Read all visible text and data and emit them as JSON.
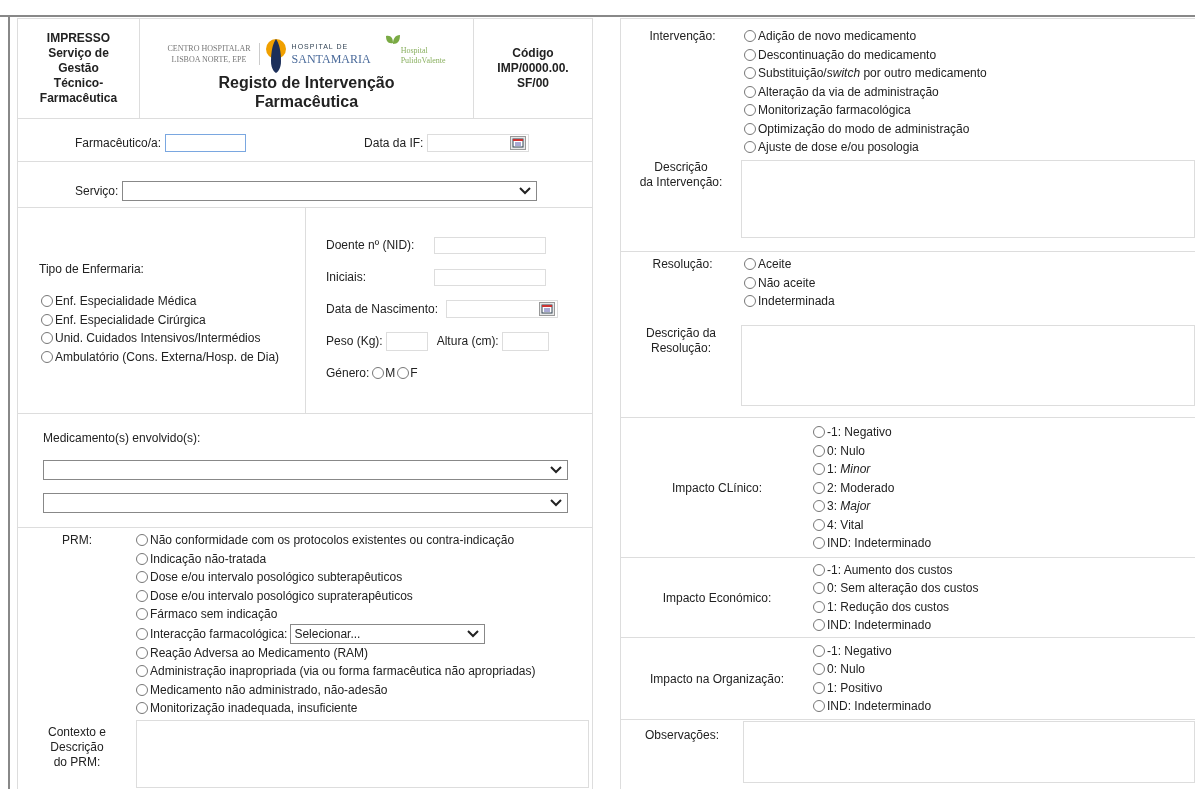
{
  "header": {
    "title_lines": [
      "IMPRESSO",
      "Serviço de",
      "Gestão",
      "Técnico-",
      "Farmacêutica"
    ],
    "logos": [
      {
        "kind": "chln",
        "lines": [
          "CENTRO HOSPITALAR",
          "LISBOA NORTE, EPE"
        ]
      },
      {
        "kind": "hsm",
        "lines": [
          "HOSPITAL DE",
          "SANTAMARIA"
        ]
      },
      {
        "kind": "hpv",
        "lines": [
          "Hospital",
          "PulidoValente"
        ]
      }
    ],
    "form_title": "Registo de Intervenção Farmacêutica",
    "code_lines": [
      "Código",
      "IMP/0000.00.",
      "SF/00"
    ]
  },
  "identification": [
    {
      "label": "Farmacêutico/a:",
      "kind": "text",
      "focused": true
    },
    {
      "label": "Data da IF:",
      "kind": "date",
      "focused": false
    }
  ],
  "service": {
    "label": "Serviço:"
  },
  "ward": {
    "label": "Tipo de Enfermaria:",
    "options": [
      {
        "label": "Enf. Especialidade Médica",
        "selected": false
      },
      {
        "label": "Enf. Especialidade Cirúrgica",
        "selected": false
      },
      {
        "label": "Unid. Cuidados Intensivos/Intermédios",
        "selected": false
      },
      {
        "label": "Ambulatório (Cons. Externa/Hosp. de Dia)",
        "selected": false
      }
    ]
  },
  "patient": {
    "fields": [
      {
        "label": "Doente nº (NID):",
        "kind": "text"
      },
      {
        "label": "Iniciais:",
        "kind": "text"
      },
      {
        "label": "Data de Nascimento:",
        "kind": "date"
      },
      {
        "label": "Peso (Kg):",
        "kind": "short"
      },
      {
        "label": "Altura (cm):",
        "kind": "short"
      }
    ],
    "gender": {
      "label": "Género:",
      "options": [
        {
          "label": "M",
          "selected": false
        },
        {
          "label": "F",
          "selected": false
        }
      ]
    }
  },
  "medications": {
    "label": "Medicamento(s) envolvido(s):",
    "fields": [
      {
        "kind": "select"
      },
      {
        "kind": "select"
      }
    ]
  },
  "prm": {
    "label": "PRM:",
    "options": [
      {
        "label": "Não conformidade com os protocolos existentes ou contra-indicação",
        "selected": false
      },
      {
        "label": "Indicação não-tratada",
        "selected": false
      },
      {
        "label": "Dose e/ou intervalo posológico subterapêuticos",
        "selected": false
      },
      {
        "label": "Dose e/ou intervalo posológico supraterapêuticos",
        "selected": false
      },
      {
        "label": "Fármaco sem indicação",
        "selected": false
      },
      {
        "label": "Interacção farmacológica:",
        "selected": false,
        "select_placeholder": "Selecionar..."
      },
      {
        "label": "Reação Adversa ao Medicamento (RAM)",
        "selected": false
      },
      {
        "label": "Administração inapropriada (via ou forma farmacêutica não apropriadas)",
        "selected": false
      },
      {
        "label": "Medicamento não administrado, não-adesão",
        "selected": false
      },
      {
        "label": "Monitorização inadequada, insuficiente",
        "selected": false
      }
    ],
    "description_label_lines": [
      "Contexto e",
      "Descrição",
      "do PRM:"
    ]
  },
  "intervention": {
    "label": "Intervenção:",
    "options": [
      {
        "label": "Adição de novo medicamento",
        "selected": false
      },
      {
        "label": "Descontinuação do medicamento",
        "selected": false
      },
      {
        "label": "Substituição/*switch* por outro medicamento",
        "selected": false
      },
      {
        "label": "Alteração da via de administração",
        "selected": false
      },
      {
        "label": "Monitorização farmacológica",
        "selected": false
      },
      {
        "label": "Optimização do modo de administração",
        "selected": false
      },
      {
        "label": "Ajuste de dose e/ou posologia",
        "selected": false
      }
    ],
    "description_label_lines": [
      "Descrição",
      "da Intervenção:"
    ]
  },
  "resolution": {
    "label": "Resolução:",
    "options": [
      {
        "label": "Aceite",
        "selected": false
      },
      {
        "label": "Não aceite",
        "selected": false
      },
      {
        "label": "Indeterminada",
        "selected": false
      }
    ],
    "description_label_lines": [
      "Descrição da",
      "Resolução:"
    ]
  },
  "impacts": [
    {
      "label": "Impacto CLínico:",
      "options": [
        {
          "label": "-1: Negativo",
          "selected": false
        },
        {
          "label": "0: Nulo",
          "selected": false
        },
        {
          "label": "1: *Minor*",
          "selected": false
        },
        {
          "label": "2: Moderado",
          "selected": false
        },
        {
          "label": "3: *Major*",
          "selected": false
        },
        {
          "label": "4: Vital",
          "selected": false
        },
        {
          "label": "IND: Indeterminado",
          "selected": false
        }
      ]
    },
    {
      "label": "Impacto Económico:",
      "options": [
        {
          "label": "-1: Aumento dos custos",
          "selected": false
        },
        {
          "label": "0: Sem alteração dos custos",
          "selected": false
        },
        {
          "label": "1: Redução dos custos",
          "selected": false
        },
        {
          "label": "IND: Indeterminado",
          "selected": false
        }
      ]
    },
    {
      "label": "Impacto na Organização:",
      "options": [
        {
          "label": "-1: Negativo",
          "selected": false
        },
        {
          "label": "0: Nulo",
          "selected": false
        },
        {
          "label": "1: Positivo",
          "selected": false
        },
        {
          "label": "IND: Indeterminado",
          "selected": false
        }
      ]
    }
  ],
  "observations": {
    "label": "Observações:"
  }
}
